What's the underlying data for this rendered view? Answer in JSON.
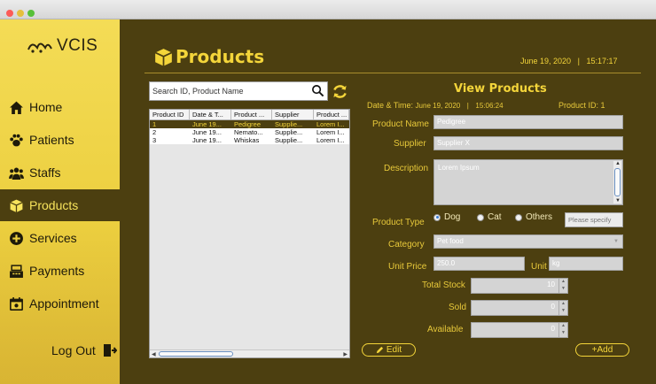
{
  "app": {
    "logo_text": "VCIS"
  },
  "sidebar": {
    "items": [
      {
        "label": "Home"
      },
      {
        "label": "Patients"
      },
      {
        "label": "Staffs"
      },
      {
        "label": "Products"
      },
      {
        "label": "Services"
      },
      {
        "label": "Payments"
      },
      {
        "label": "Appointment"
      }
    ],
    "active": "Products",
    "logout_label": "Log Out"
  },
  "header": {
    "title": "Products",
    "date": "June 19, 2020",
    "separator": "|",
    "time": "15:17:17"
  },
  "search": {
    "placeholder": "Search ID, Product Name"
  },
  "table": {
    "columns": [
      "Product ID",
      "Date & T...",
      "Product ...",
      "Supplier",
      "Product ..."
    ],
    "rows": [
      [
        "1",
        "June 19...",
        "Pedigree",
        "Supplie...",
        "Lorem I..."
      ],
      [
        "2",
        "June 19...",
        "Nemato...",
        "Supplie...",
        "Lorem I..."
      ],
      [
        "3",
        "June 19...",
        "Whiskas",
        "Supplie...",
        "Lorem I..."
      ]
    ],
    "selected_row": 0
  },
  "panel": {
    "title": "View Products",
    "datetime_label": "Date & Time:",
    "date": "June 19, 2020",
    "separator": "|",
    "time": "15:06:24",
    "product_id_label": "Product ID:",
    "product_id": "1",
    "product_name_label": "Product Name",
    "product_name": "Pedigree",
    "supplier_label": "Supplier",
    "supplier": "Supplier X",
    "description_label": "Description",
    "description": "Lorem Ipsum",
    "product_type_label": "Product Type",
    "product_type_options": [
      "Dog",
      "Cat",
      "Others"
    ],
    "product_type_selected": "Dog",
    "specify_placeholder": "Please specify",
    "category_label": "Category",
    "category": "Pet food",
    "unit_price_label": "Unit Price",
    "unit_price": "250.0",
    "unit_label": "Unit",
    "unit": "kg",
    "total_stock_label": "Total Stock",
    "total_stock": "10",
    "sold_label": "Sold",
    "sold": "0",
    "available_label": "Available",
    "available": "0",
    "edit_label": "Edit",
    "add_label": "+Add"
  },
  "colors": {
    "background": "#4c3f10",
    "accent": "#f4d53a",
    "sidebar": "#f0d84a"
  }
}
